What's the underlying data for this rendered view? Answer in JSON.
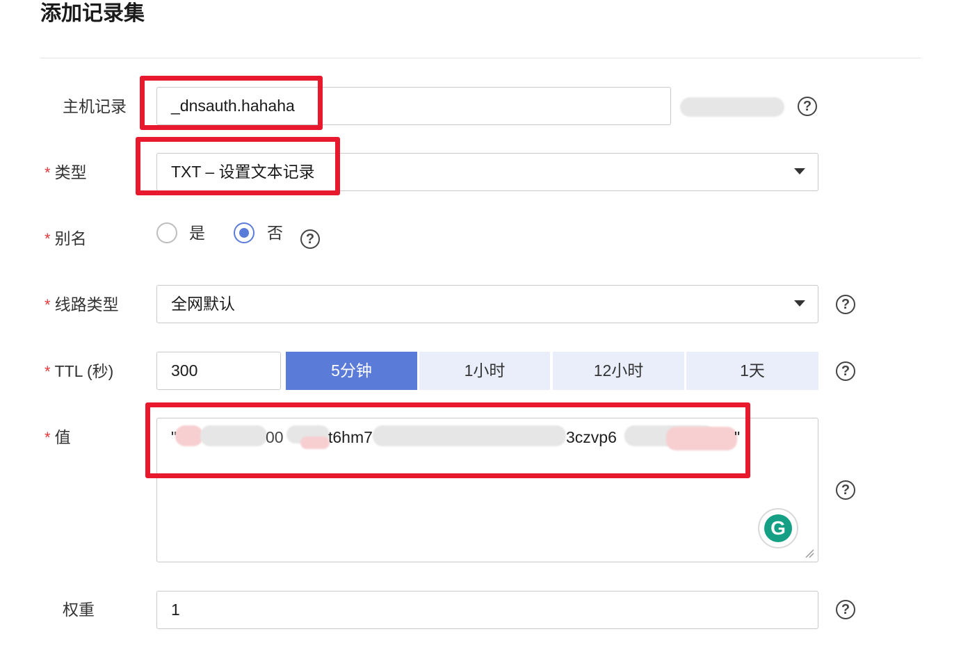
{
  "page_title": "添加记录集",
  "host_record": {
    "label": "主机记录",
    "value": "_dnsauth.hahaha"
  },
  "type": {
    "label": "类型",
    "value": "TXT – 设置文本记录"
  },
  "alias": {
    "label": "别名",
    "options": [
      "是",
      "否"
    ],
    "selected": "否"
  },
  "line_type": {
    "label": "线路类型",
    "value": "全网默认"
  },
  "ttl": {
    "label": "TTL (秒)",
    "value": "300",
    "presets": [
      "5分钟",
      "1小时",
      "12小时",
      "1天"
    ],
    "active_preset": "5分钟"
  },
  "record_value": {
    "label": "值",
    "visible_fragments": [
      "\"",
      "00",
      "t6hm7",
      "3czvp6",
      "\""
    ]
  },
  "weight": {
    "label": "权重",
    "value": "1"
  },
  "help_icon_glyph": "?",
  "grammarly_glyph": "G",
  "colors": {
    "accent": "#5b7bd9",
    "highlight": "#e8192c",
    "required": "#e4393c",
    "segment_bg": "#e9eefa"
  }
}
